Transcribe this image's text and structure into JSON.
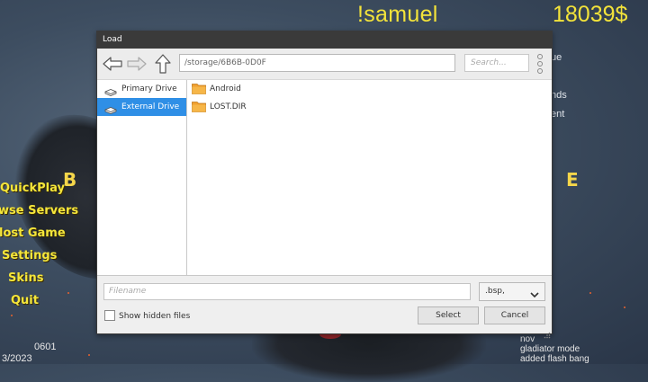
{
  "hud": {
    "player_name": "!samuel",
    "money": "18039$"
  },
  "main_menu": {
    "items": [
      "QuickPlay",
      "wse Servers",
      "lost Game",
      "Settings",
      "Skins",
      "Quit"
    ],
    "logo_left": "B",
    "logo_right": "E"
  },
  "right_menu": {
    "items": [
      "ue",
      "nds",
      "ent"
    ]
  },
  "bottom_left": {
    "version": "0601",
    "date": "3/2023"
  },
  "changelog": {
    "lines": [
      "nov",
      "gladiator mode",
      "added flash bang"
    ]
  },
  "dialog": {
    "title": "Load",
    "path": "/storage/6B6B-0D0F",
    "search_placeholder": "Search...",
    "sidebar": [
      {
        "label": "Primary Drive",
        "icon": "drive-icon",
        "selected": false
      },
      {
        "label": "External Drive",
        "icon": "drive-icon",
        "selected": true
      }
    ],
    "files": [
      {
        "name": "Android",
        "icon": "folder-icon"
      },
      {
        "name": "LOST.DIR",
        "icon": "folder-icon"
      }
    ],
    "filename_placeholder": "Filename",
    "filter_value": ".bsp,",
    "show_hidden_label": "Show hidden files",
    "show_hidden_checked": false,
    "select_label": "Select",
    "cancel_label": "Cancel"
  },
  "colors": {
    "hud_yellow": "#f3e33a",
    "selection_blue": "#2f8fe6",
    "titlebar": "#3a3a3a",
    "folder_orange": "#f0a030"
  }
}
